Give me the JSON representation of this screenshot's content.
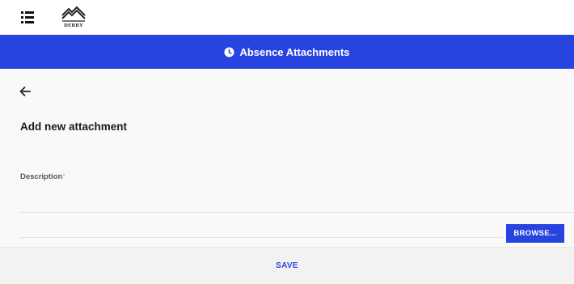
{
  "header": {
    "menu_icon": "hamburger-menu-icon",
    "logo_text": "DERBY",
    "logo_icon": "university-of-derby-logo"
  },
  "title_bar": {
    "icon": "clock-icon",
    "title": "Absence Attachments",
    "background": "#2844e0"
  },
  "page": {
    "back_icon": "arrow-left-icon",
    "heading": "Add new attachment"
  },
  "form": {
    "description_label": "Description",
    "required_marker": "*",
    "description_value": "",
    "browse_label": "BROWSE..."
  },
  "footer": {
    "save_label": "SAVE"
  },
  "colors": {
    "accent": "#2844e0",
    "content_background": "#f9f9f9"
  }
}
